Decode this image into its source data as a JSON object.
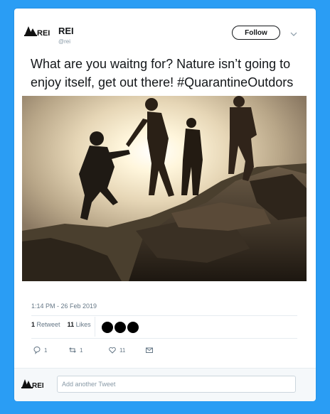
{
  "account": {
    "name": "REI",
    "handle": "@rei",
    "logo_text": "REI"
  },
  "header": {
    "follow_label": "Follow"
  },
  "tweet": {
    "text": "What are you waitng for? Nature isn’t going to enjoy itself, get out there! #QuarantineOutdors",
    "timestamp": "1:14 PM - 26 Feb 2019"
  },
  "stats": {
    "retweets_count": "1",
    "retweets_label": "Retweet",
    "likes_count": "11",
    "likes_label": "Likes",
    "liker_avatars": 3
  },
  "actions": {
    "reply_count": "1",
    "retweet_count": "1",
    "like_count": "11"
  },
  "reply": {
    "placeholder": "Add another Tweet"
  },
  "colors": {
    "background": "#2a9df4",
    "text_primary": "#14171a",
    "text_secondary": "#657786"
  }
}
